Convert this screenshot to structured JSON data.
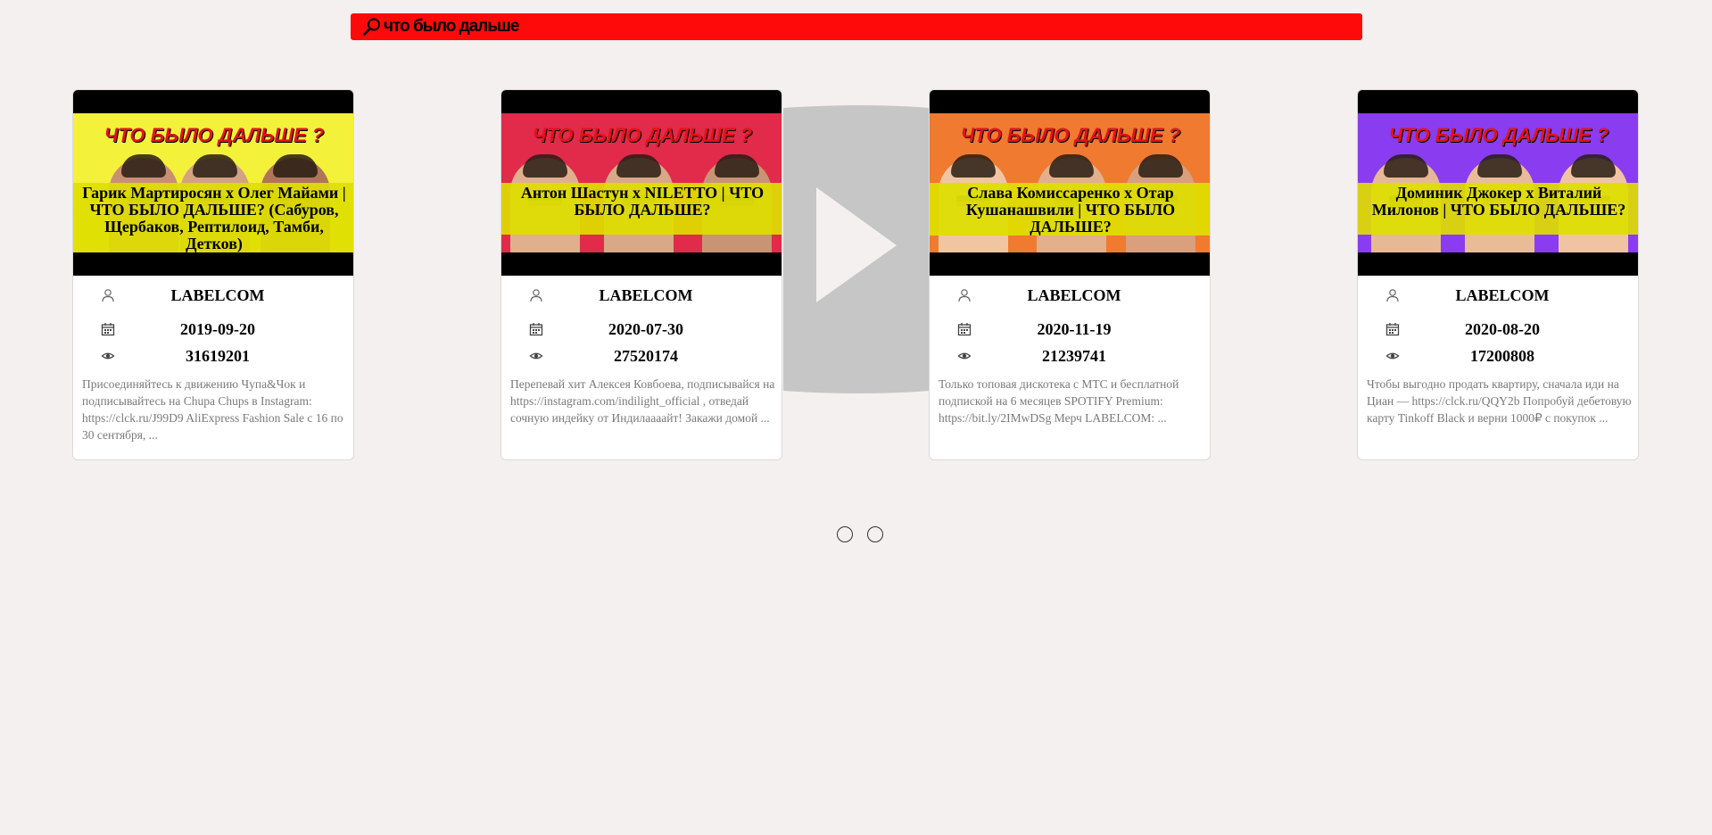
{
  "search": {
    "value": "что было дальше",
    "icon": "search-icon"
  },
  "colors": {
    "search_bg": "#ff0a0a",
    "title_band": "#dede00",
    "page_bg": "#f3f0ef"
  },
  "cards": [
    {
      "thumbnail_banner": "ЧТО БЫЛО ДАЛЬШЕ ?",
      "thumbnail_bg": "#f4f13a",
      "title": "Гарик Мартиросян x Олег Майами | ЧТО БЫЛО ДАЛЬШЕ? (Сабуров, Щербаков, Рептилоид, Тамби, Детков)",
      "channel": "LABELCOM",
      "date": "2019-09-20",
      "views": "31619201",
      "description": "Присоединяйтесь к движению Чупа&Чок и подписывайтесь на Chupa Chups в Instagram: https://clck.ru/J99D9 AliExpress Fashion Sale с 16 по 30 сентября, ..."
    },
    {
      "thumbnail_banner": "ЧТО БЫЛО ДАЛЬШЕ ?",
      "thumbnail_bg": "#e22a4a",
      "title": "Антон Шастун x NILETTO | ЧТО БЫЛО ДАЛЬШЕ?",
      "channel": "LABELCOM",
      "date": "2020-07-30",
      "views": "27520174",
      "description": "Перепевай хит Алексея Ковбоева, подписывайся на https://instagram.com/indilight_official , отведай сочную индейку от Индилаааайт! Закажи домой ..."
    },
    {
      "thumbnail_banner": "ЧТО БЫЛО ДАЛЬШЕ ?",
      "thumbnail_bg": "#f07a30",
      "title": "Слава Комиссаренко x Отар Кушанашвили | ЧТО БЫЛО ДАЛЬШЕ?",
      "channel": "LABELCOM",
      "date": "2020-11-19",
      "views": "21239741",
      "description": "Только топовая дискотека с МТС и бесплатной подпиской на 6 месяцев SPOTIFY Premium: https://bit.ly/2IMwDSg Мерч LABELCOM: ..."
    },
    {
      "thumbnail_banner": "ЧТО БЫЛО ДАЛЬШЕ ?",
      "thumbnail_bg": "#8a3cf0",
      "title": "Доминик Джокер x Виталий Милонов | ЧТО БЫЛО ДАЛЬШЕ?",
      "channel": "LABELCOM",
      "date": "2020-08-20",
      "views": "17200808",
      "description": "Чтобы выгодно продать квартиру, сначала иди на Циан — https://clck.ru/QQY2b Попробуй дебетовую карту Tinkoff Black и верни 1000₽ с покупок ..."
    }
  ],
  "pagination": {
    "pages": 2
  }
}
